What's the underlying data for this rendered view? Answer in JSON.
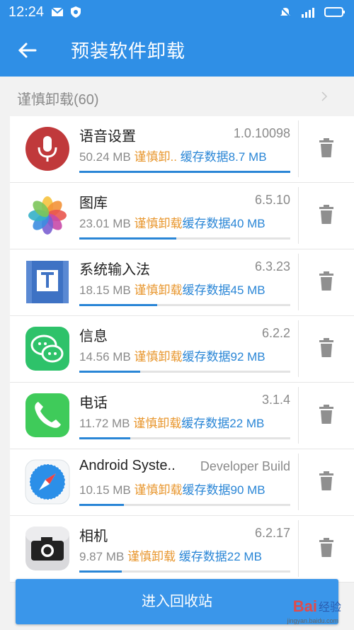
{
  "status_bar": {
    "time": "12:24"
  },
  "header": {
    "title": "预装软件卸载",
    "back_icon": "arrow-left-icon"
  },
  "section": {
    "title": "谨慎卸载(60)"
  },
  "colors": {
    "primary": "#2f8fe6",
    "warning": "#e8962d",
    "info": "#2a86d6"
  },
  "apps": [
    {
      "name": "语音设置",
      "version": "1.0.10098",
      "size": "50.24 MB",
      "tag": "谨慎卸..",
      "cache": "缓存数据8.7 MB",
      "usage": 1.0,
      "icon": "microphone-icon"
    },
    {
      "name": "图库",
      "version": "6.5.10",
      "size": "23.01 MB",
      "tag": "谨慎卸载",
      "cache": "缓存数据40 MB",
      "usage": 0.46,
      "icon": "gallery-flower-icon"
    },
    {
      "name": "系统输入法",
      "version": "6.3.23",
      "size": "18.15 MB",
      "tag": "谨慎卸载",
      "cache": "缓存数据45 MB",
      "usage": 0.37,
      "icon": "keyboard-t-icon"
    },
    {
      "name": "信息",
      "version": "6.2.2",
      "size": "14.56 MB",
      "tag": "谨慎卸载",
      "cache": "缓存数据92 MB",
      "usage": 0.29,
      "icon": "chat-bubble-icon"
    },
    {
      "name": "电话",
      "version": "3.1.4",
      "size": "11.72 MB",
      "tag": "谨慎卸载",
      "cache": "缓存数据22 MB",
      "usage": 0.24,
      "icon": "phone-icon"
    },
    {
      "name": "Android Syste..",
      "version": "Developer Build",
      "size": "10.15 MB",
      "tag": "谨慎卸载",
      "cache": "缓存数据90 MB",
      "usage": 0.21,
      "icon": "compass-icon"
    },
    {
      "name": "相机",
      "version": "6.2.17",
      "size": "9.87 MB",
      "tag": "谨慎卸载",
      "cache": "缓存数据22 MB",
      "usage": 0.2,
      "icon": "camera-icon"
    }
  ],
  "footer": {
    "button_label": "进入回收站"
  },
  "watermark": {
    "brand": "Bai",
    "brand_cn": "经验",
    "url": "jingyan.baidu.com"
  }
}
